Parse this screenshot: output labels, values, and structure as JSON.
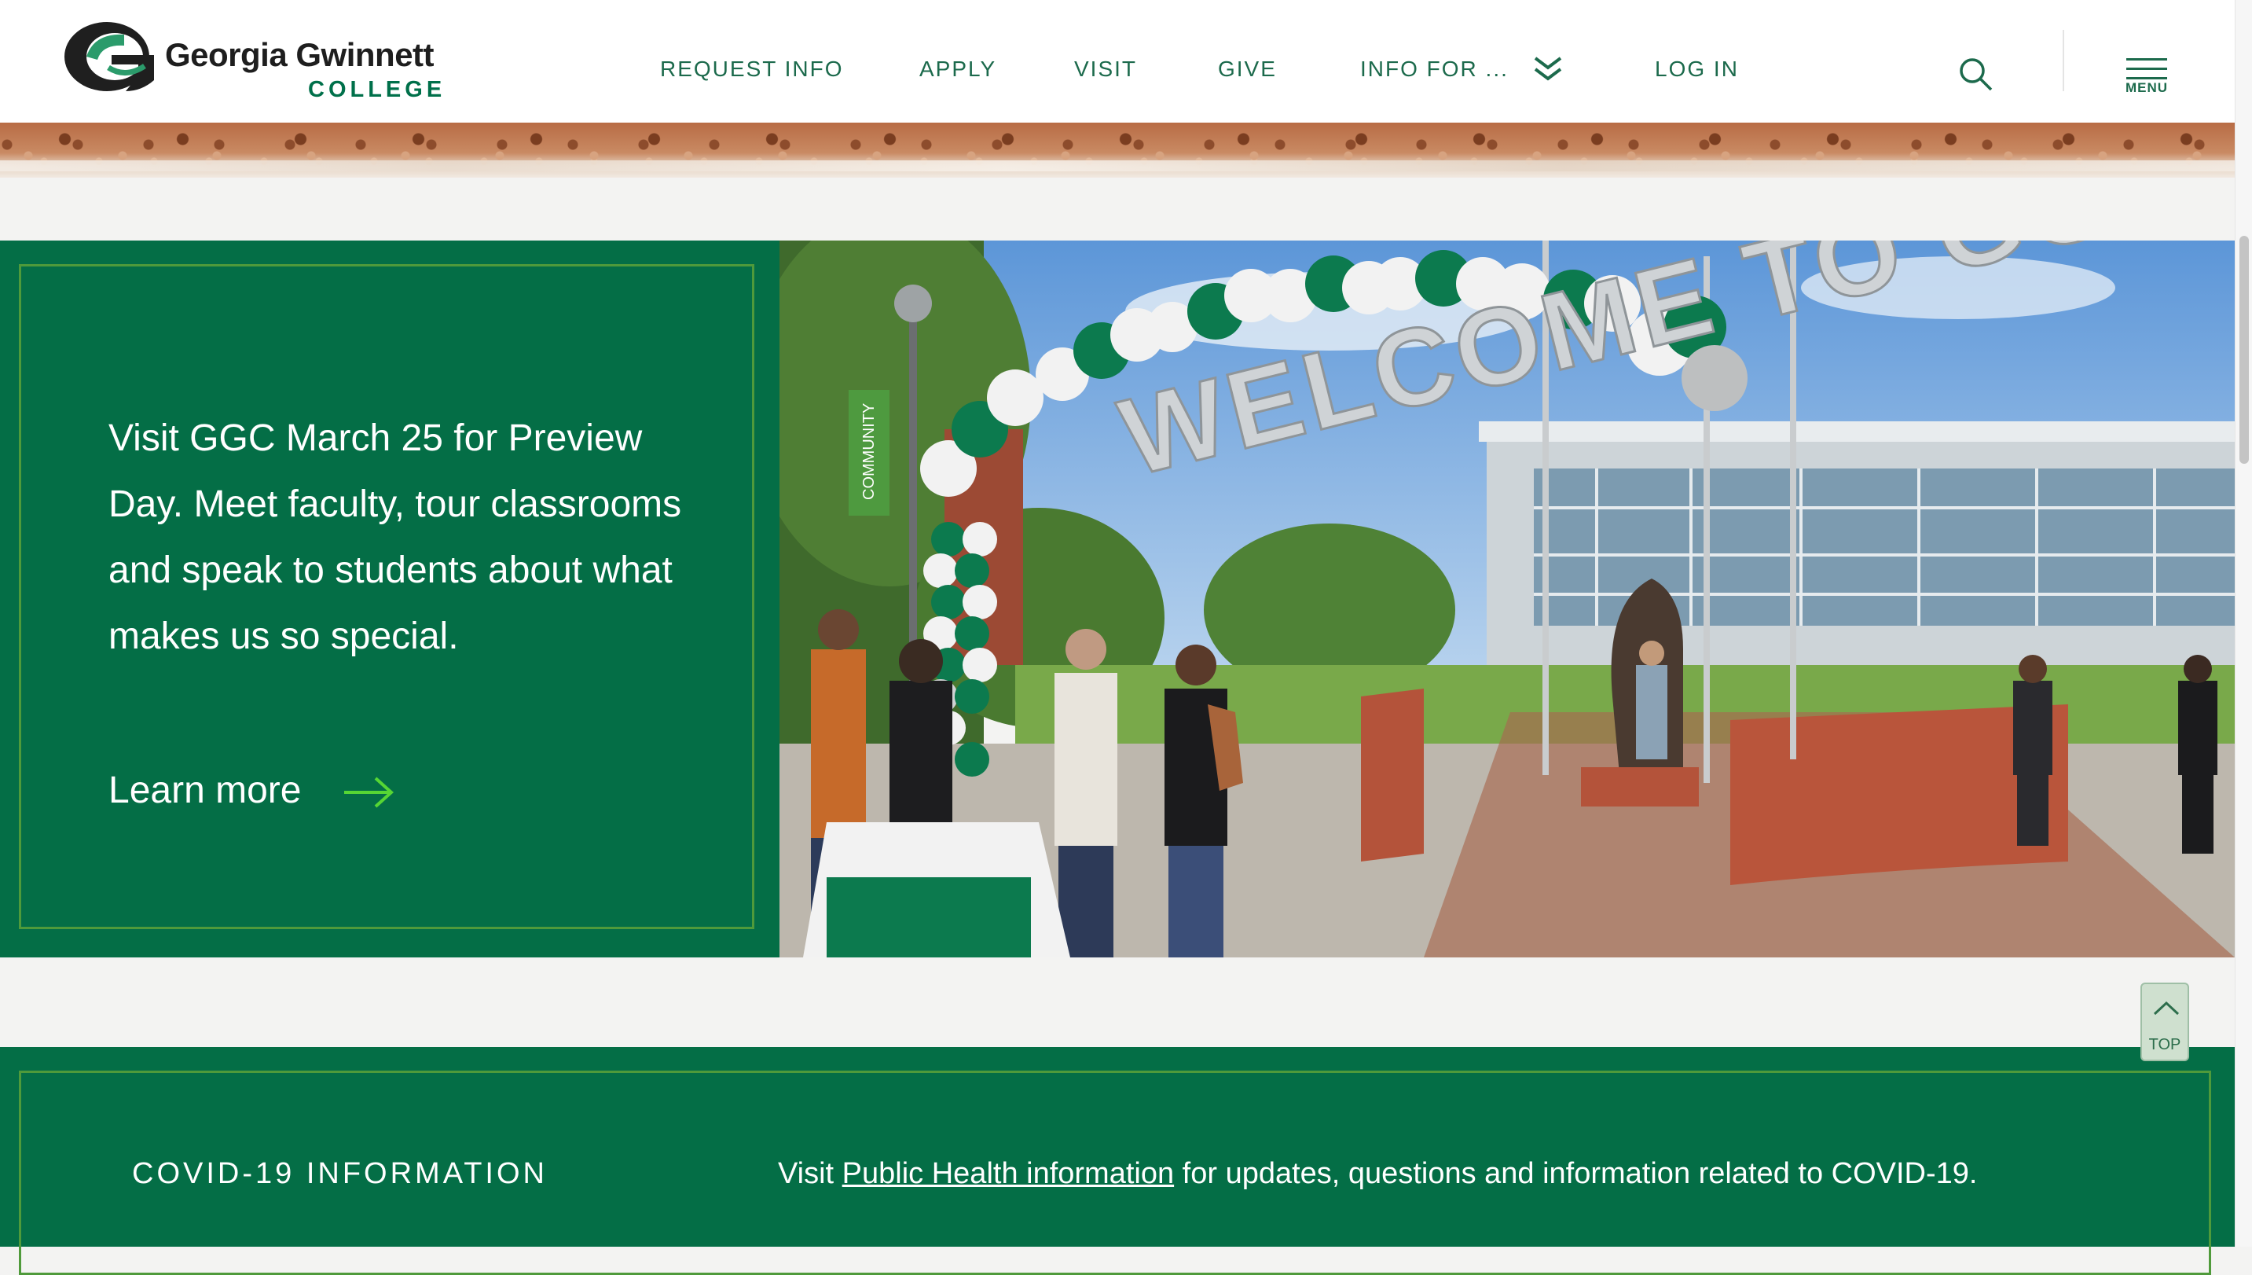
{
  "header": {
    "logo_line1": "Georgia Gwinnett",
    "logo_line2": "COLLEGE",
    "nav": [
      "REQUEST INFO",
      "APPLY",
      "VISIT",
      "GIVE",
      "INFO FOR ...",
      "LOG IN"
    ],
    "menu_label": "MENU",
    "brand_color": "#00704a"
  },
  "promo": {
    "text": "Visit GGC March 25 for Preview Day. Meet faculty, tour classrooms and speak to students about what makes us so special.",
    "link_label": "Learn more",
    "background": "#046e46",
    "photo_banner": "WELCOME TO GGC",
    "photo_sign": "COMMUNITY"
  },
  "covid": {
    "heading": "COVID-19 INFORMATION",
    "text_before": "Visit ",
    "link_label": "Public Health information",
    "text_after": " for updates, questions and information related to COVID-19."
  },
  "top_button": {
    "label": "TOP"
  }
}
